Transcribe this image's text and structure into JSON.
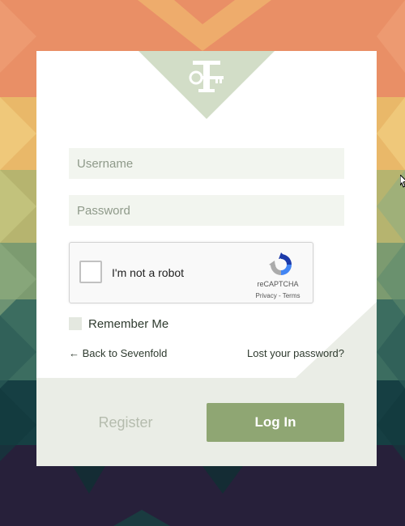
{
  "logo": {
    "letter": "T",
    "name": "sevenfold-key-logo"
  },
  "form": {
    "username_placeholder": "Username",
    "password_placeholder": "Password",
    "username_value": "",
    "password_value": ""
  },
  "captcha": {
    "label": "I'm not a robot",
    "brand": "reCAPTCHA",
    "links": "Privacy - Terms",
    "checked": false
  },
  "remember": {
    "label": "Remember Me",
    "checked": false
  },
  "links": {
    "back": "← Back to Sevenfold",
    "lost_password": "Lost your password?"
  },
  "actions": {
    "register": "Register",
    "login": "Log In"
  },
  "colors": {
    "accent": "#8fa673",
    "field_bg": "#f2f5ef",
    "footer_bg": "#eaede6",
    "logo_triangle": "#d2ddc7"
  }
}
